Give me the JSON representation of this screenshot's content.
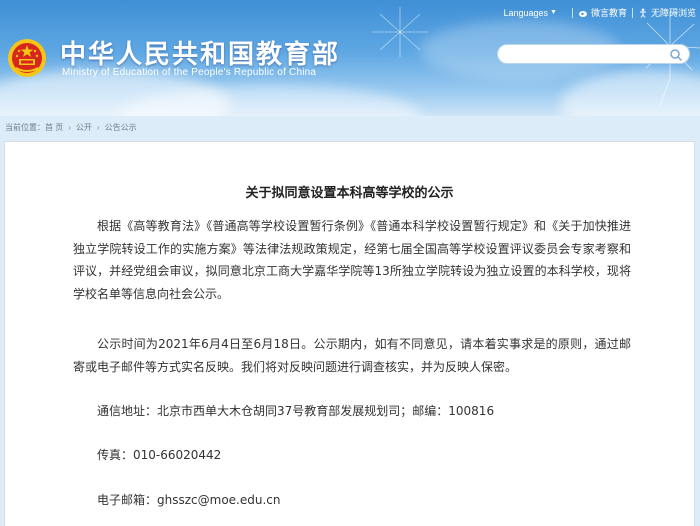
{
  "header": {
    "site_title_cn": "中华人民共和国教育部",
    "site_title_en": "Ministry of Education of the People's Republic of China",
    "top_links": {
      "language": "Languages",
      "weibo": "微言教育",
      "accessible": "无障碍浏览"
    },
    "search": {
      "placeholder": ""
    }
  },
  "breadcrumb": {
    "prefix": "当前位置：",
    "items": [
      "首 页",
      "公开",
      "公告公示"
    ]
  },
  "article": {
    "title": "关于拟同意设置本科高等学校的公示",
    "paragraph1": "根据《高等教育法》《普通高等学校设置暂行条例》《普通本科学校设置暂行规定》和《关于加快推进独立学院转设工作的实施方案》等法律法规政策规定，经第七届全国高等学校设置评议委员会专家考察和评议，并经党组会审议，拟同意北京工商大学嘉华学院等13所独立学院转设为独立设置的本科学校，现将学校名单等信息向社会公示。",
    "paragraph2": "公示时间为2021年6月4日至6月18日。公示期内，如有不同意见，请本着实事求是的原则，通过邮寄或电子邮件等方式实名反映。我们将对反映问题进行调查核实，并为反映人保密。",
    "address": "通信地址：北京市西单大木仓胡同37号教育部发展规划司；邮编：100816",
    "fax": "传真：010-66020442",
    "email": "电子邮箱：ghsszc@moe.edu.cn"
  },
  "colors": {
    "header_blue": "#3f8fd6",
    "emblem_red": "#d7261e",
    "emblem_gold": "#f6c516"
  },
  "icons": [
    "national-emblem-icon",
    "globe-icon",
    "weibo-icon",
    "accessibility-icon",
    "search-icon"
  ]
}
